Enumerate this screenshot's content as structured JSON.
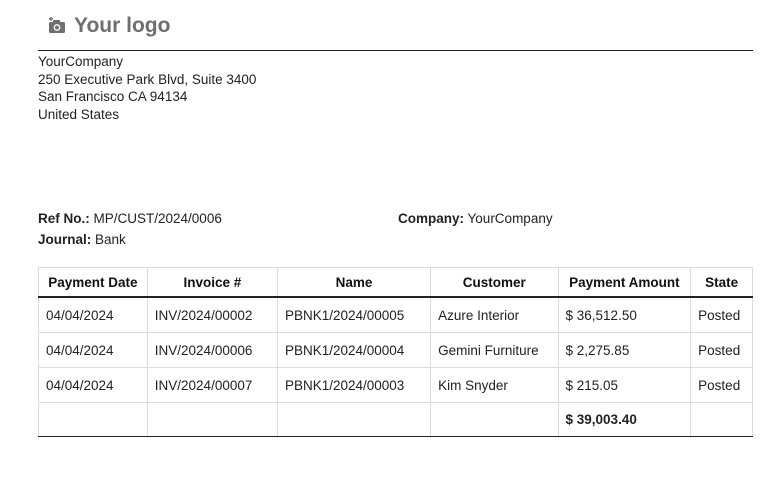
{
  "header": {
    "logo_text": "Your logo",
    "logo_icon": "camera-icon"
  },
  "company": {
    "name": "YourCompany",
    "street": "250 Executive Park Blvd, Suite 3400",
    "city": "San Francisco CA 94134",
    "country": "United States"
  },
  "meta": {
    "ref_label": "Ref No.:",
    "ref_value": "MP/CUST/2024/0006",
    "company_label": "Company:",
    "company_value": "YourCompany",
    "journal_label": "Journal:",
    "journal_value": "Bank"
  },
  "table": {
    "headers": [
      "Payment Date",
      "Invoice #",
      "Name",
      "Customer",
      "Payment Amount",
      "State"
    ],
    "rows": [
      [
        "04/04/2024",
        "INV/2024/00002",
        "PBNK1/2024/00005",
        "Azure Interior",
        "$ 36,512.50",
        "Posted"
      ],
      [
        "04/04/2024",
        "INV/2024/00006",
        "PBNK1/2024/00004",
        "Gemini Furniture",
        "$ 2,275.85",
        "Posted"
      ],
      [
        "04/04/2024",
        "INV/2024/00007",
        "PBNK1/2024/00003",
        "Kim Snyder",
        "$ 215.05",
        "Posted"
      ]
    ],
    "total": "$ 39,003.40"
  }
}
